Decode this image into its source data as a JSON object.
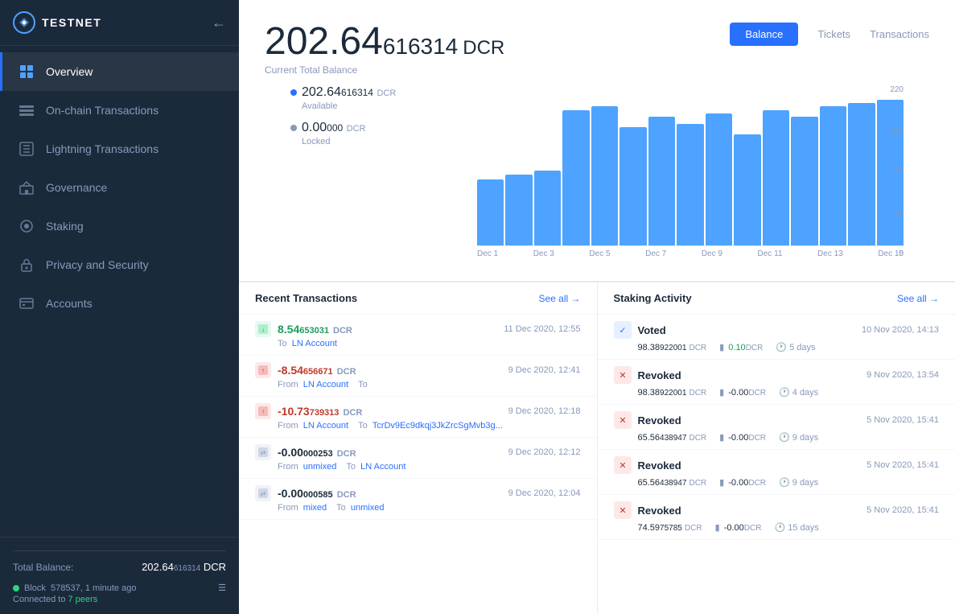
{
  "app": {
    "name": "TESTNET",
    "network": "testnet"
  },
  "sidebar": {
    "nav_items": [
      {
        "id": "overview",
        "label": "Overview",
        "active": true
      },
      {
        "id": "onchain",
        "label": "On-chain Transactions",
        "active": false
      },
      {
        "id": "lightning",
        "label": "Lightning Transactions",
        "active": false
      },
      {
        "id": "governance",
        "label": "Governance",
        "active": false
      },
      {
        "id": "staking",
        "label": "Staking",
        "active": false
      },
      {
        "id": "privacy",
        "label": "Privacy and Security",
        "active": false
      },
      {
        "id": "accounts",
        "label": "Accounts",
        "active": false
      }
    ],
    "footer": {
      "total_balance_label": "Total Balance:",
      "total_balance": "202.64",
      "total_balance_decimals": "616314",
      "total_balance_currency": "DCR",
      "block_label": "Block",
      "block_number": "578537",
      "block_time": "1 minute ago",
      "connected_label": "Connected to",
      "peers": "7 peers"
    }
  },
  "main": {
    "balance": {
      "whole": "202.64",
      "decimals": "616314",
      "currency": "DCR",
      "label": "Current Total Balance"
    },
    "tabs": [
      {
        "label": "Balance",
        "active": true
      },
      {
        "label": "Tickets",
        "active": false
      },
      {
        "label": "Transactions",
        "active": false
      }
    ],
    "available": {
      "amount": "202.64",
      "decimals": "616314",
      "currency": "DCR",
      "label": "Available"
    },
    "locked": {
      "amount": "0.00",
      "decimals": "000",
      "currency": "DCR",
      "label": "Locked"
    },
    "chart": {
      "bars": [
        95,
        102,
        108,
        195,
        200,
        170,
        185,
        175,
        190,
        160,
        195,
        185,
        200,
        205,
        210
      ],
      "y_labels": [
        "220",
        "165",
        "110",
        "55",
        "0"
      ],
      "x_labels": [
        "Dec 1",
        "Dec 3",
        "Dec 5",
        "Dec 7",
        "Dec 9",
        "Dec 11",
        "Dec 13",
        "Dec 15"
      ]
    },
    "recent_transactions": {
      "title": "Recent Transactions",
      "see_all": "See all →",
      "items": [
        {
          "amount": "8.54",
          "decimals": "653031",
          "currency": "DCR",
          "type": "positive",
          "date": "11 Dec 2020, 12:55",
          "from": "",
          "to": "LN Account"
        },
        {
          "amount": "-8.54",
          "decimals": "656671",
          "currency": "DCR",
          "type": "negative",
          "date": "9 Dec 2020, 12:41",
          "from": "LN Account",
          "to": ""
        },
        {
          "amount": "-10.73",
          "decimals": "739313",
          "currency": "DCR",
          "type": "negative",
          "date": "9 Dec 2020, 12:18",
          "from": "LN Account",
          "to": "TcrDv9Ec9dkqj3JkZrcSgMvb3g..."
        },
        {
          "amount": "-0.00",
          "decimals": "000253",
          "currency": "DCR",
          "type": "gray",
          "date": "9 Dec 2020, 12:12",
          "from": "unmixed",
          "to": "LN Account"
        },
        {
          "amount": "-0.00",
          "decimals": "000585",
          "currency": "DCR",
          "type": "gray",
          "date": "9 Dec 2020, 12:04",
          "from": "mixed",
          "to": "unmixed"
        }
      ]
    },
    "staking_activity": {
      "title": "Staking Activity",
      "see_all": "See all →",
      "items": [
        {
          "type": "Voted",
          "date": "10 Nov 2020, 14:13",
          "price": "98.38",
          "price_decimals": "922001",
          "price_currency": "DCR",
          "reward": "0.10",
          "reward_currency": "DCR",
          "days": "5 days"
        },
        {
          "type": "Revoked",
          "date": "9 Nov 2020, 13:54",
          "price": "98.38",
          "price_decimals": "922001",
          "price_currency": "DCR",
          "reward": "-0.00",
          "reward_currency": "DCR",
          "days": "4 days"
        },
        {
          "type": "Revoked",
          "date": "5 Nov 2020, 15:41",
          "price": "65.56",
          "price_decimals": "438947",
          "price_currency": "DCR",
          "reward": "-0.00",
          "reward_currency": "DCR",
          "days": "9 days"
        },
        {
          "type": "Revoked",
          "date": "5 Nov 2020, 15:41",
          "price": "65.56",
          "price_decimals": "438947",
          "price_currency": "DCR",
          "reward": "-0.00",
          "reward_currency": "DCR",
          "days": "9 days"
        },
        {
          "type": "Revoked",
          "date": "5 Nov 2020, 15:41",
          "price": "74.59",
          "price_decimals": "75785",
          "price_currency": "DCR",
          "reward": "-0.00",
          "reward_currency": "DCR",
          "days": "15 days"
        }
      ]
    }
  }
}
